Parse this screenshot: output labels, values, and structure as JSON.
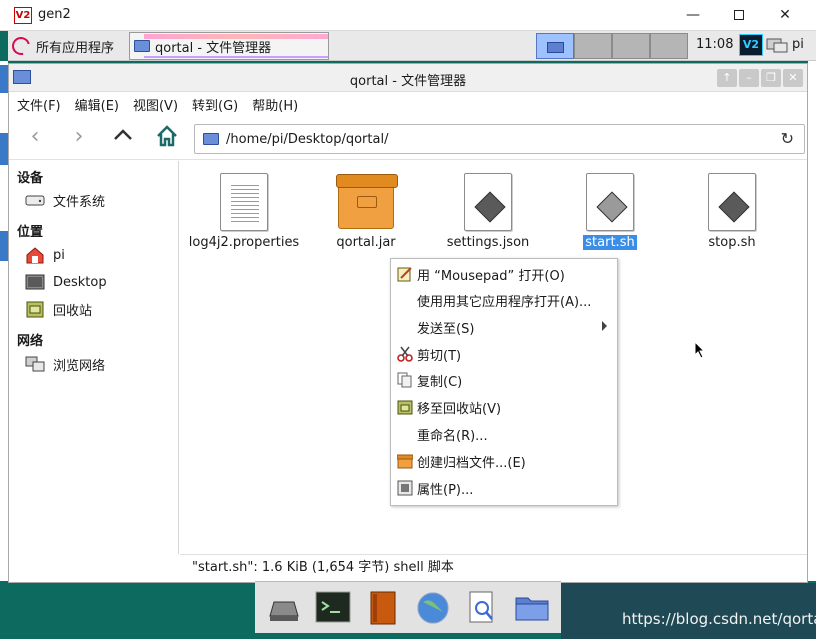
{
  "vnc": {
    "logo": "V2",
    "title": "gen2",
    "min": "—",
    "close": "✕"
  },
  "panel": {
    "menu_label": "所有应用程序",
    "task_title": "qortal - 文件管理器",
    "clock": "11:08",
    "tray_logo": "V2",
    "user": "pi"
  },
  "fm": {
    "title": "qortal - 文件管理器",
    "title_buttons": [
      "↑",
      "–",
      "❐",
      "✕"
    ],
    "menu": [
      "文件(F)",
      "编辑(E)",
      "视图(V)",
      "转到(G)",
      "帮助(H)"
    ],
    "path": "/home/pi/Desktop/qortal/",
    "sidebar": {
      "devices_heading": "设备",
      "devices": [
        "文件系统"
      ],
      "places_heading": "位置",
      "places": [
        "pi",
        "Desktop",
        "回收站"
      ],
      "network_heading": "网络",
      "network": [
        "浏览网络"
      ]
    },
    "files": [
      {
        "name": "log4j2.properties",
        "kind": "text-icon"
      },
      {
        "name": "qortal.jar",
        "kind": "archive-icon"
      },
      {
        "name": "settings.json",
        "kind": "file-icon"
      },
      {
        "name": "start.sh",
        "kind": "script-icon",
        "selected": true
      },
      {
        "name": "stop.sh",
        "kind": "script-icon"
      }
    ],
    "status": "\"start.sh\": 1.6 KiB (1,654 字节) shell 脚本"
  },
  "context_menu": [
    {
      "label": "用 “Mousepad” 打开(O)",
      "icon": "edit-icon"
    },
    {
      "label": "使用用其它应用程序打开(A)...",
      "icon": ""
    },
    {
      "label": "发送至(S)",
      "icon": "",
      "submenu": true
    },
    {
      "label": "剪切(T)",
      "icon": "scissors-icon"
    },
    {
      "label": "复制(C)",
      "icon": "copy-icon"
    },
    {
      "label": "移至回收站(V)",
      "icon": "trash-icon"
    },
    {
      "label": "重命名(R)...",
      "icon": ""
    },
    {
      "label": "创建归档文件...(E)",
      "icon": "archive-icon"
    },
    {
      "label": "属性(P)...",
      "icon": "properties-icon"
    }
  ],
  "watermark": "https://blog.csdn.net/qortal",
  "colors": {
    "selection": "#3b8ee8",
    "desktop": "#0c6a5e"
  }
}
